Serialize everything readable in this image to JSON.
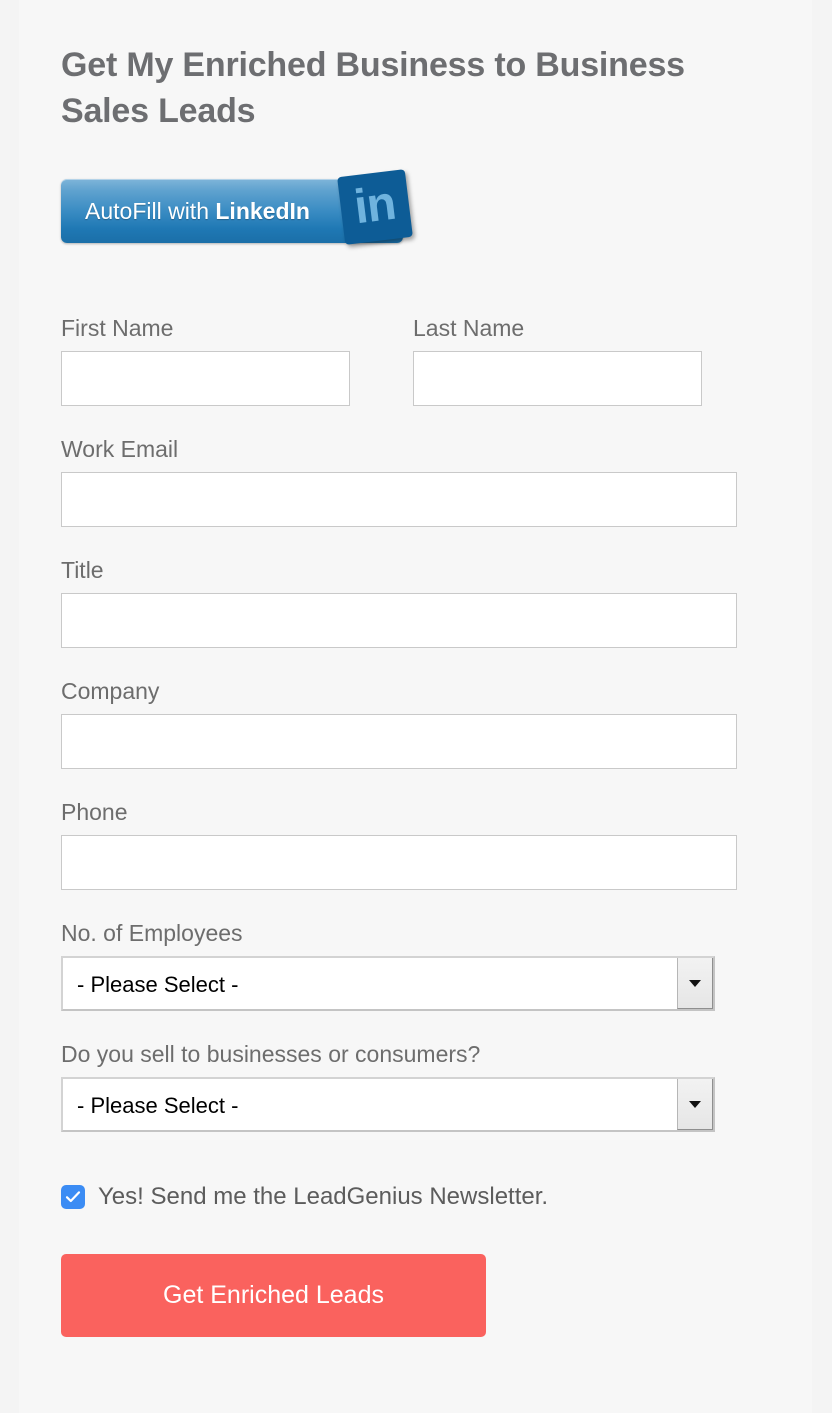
{
  "form": {
    "heading": "Get My Enriched Business to Business Sales Leads",
    "autofill": {
      "label_prefix": "AutoFill with ",
      "label_brand": "LinkedIn",
      "logo_text": "in",
      "logo_bg": "#0d5c96",
      "logo_fg": "#6fb3de",
      "button_color": "#1f78b4"
    },
    "fields": {
      "first_name": {
        "label": "First Name",
        "value": "",
        "placeholder": ""
      },
      "last_name": {
        "label": "Last Name",
        "value": "",
        "placeholder": ""
      },
      "work_email": {
        "label": "Work Email",
        "value": "",
        "placeholder": ""
      },
      "title": {
        "label": "Title",
        "value": "",
        "placeholder": ""
      },
      "company": {
        "label": "Company",
        "value": "",
        "placeholder": ""
      },
      "phone": {
        "label": "Phone",
        "value": "",
        "placeholder": ""
      },
      "employees": {
        "label": "No. of Employees",
        "selected": "- Please Select -"
      },
      "sell_to": {
        "label": "Do you sell to businesses or consumers?",
        "selected": "- Please Select -"
      }
    },
    "newsletter": {
      "label": "Yes! Send me the LeadGenius Newsletter.",
      "checked": true,
      "check_color": "#3b8cf4"
    },
    "submit": {
      "label": "Get Enriched Leads",
      "color": "#fa625e"
    }
  }
}
